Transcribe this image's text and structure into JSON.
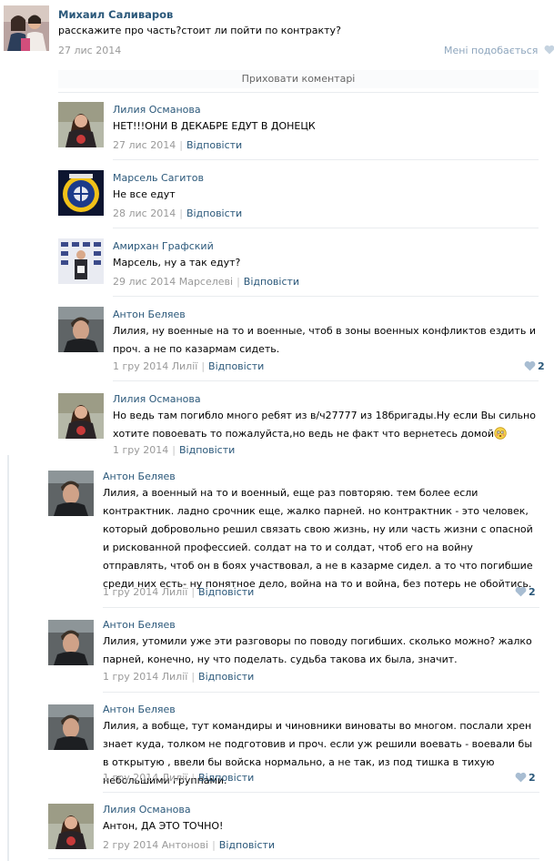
{
  "post": {
    "author": "Михаил Саливаров",
    "text": "расскажите про часть?стоит ли пойти по контракту?",
    "date": "27 лис 2014",
    "like_label": "Мені подобається"
  },
  "hide_comments": "Приховати коментарі",
  "reply_label": "Відповісти",
  "comments": [
    {
      "author": "Лилия Османова",
      "text": "НЕТ!!!ОНИ В ДЕКАБРЕ ЕДУТ В ДОНЕЦК",
      "date": "27 лис 2014"
    },
    {
      "author": "Марсель Сагитов",
      "text": "Не все едут",
      "date": "28 лис 2014"
    },
    {
      "author": "Амирхан Графский",
      "text": "Марсель, ну а так едут?",
      "date": "29 лис 2014 Марселеві"
    },
    {
      "author": "Антон Беляев",
      "text": "Лилия, ну военные на то и военные, чтоб в зоны военных конфликтов ездить и проч. а не по казармам сидеть.",
      "date": "1 гру 2014 Лилії",
      "likes": "2"
    },
    {
      "author": "Лилия Османова",
      "text": "Но ведь там погибло много ребят из в/ч27777 из 18бригады.Ну если Вы сильно хотите повоевать то пожалуйста,но ведь не факт что вернетесь домой",
      "date": "1 гру 2014"
    },
    {
      "author": "Антон Беляев",
      "text": "Лилия, а военный на то и военный, еще раз повторяю. тем более если контрактник. ладно срочник еще, жалко парней. но контрактник - это человек, который добровольно решил связать свою жизнь, ну или часть жизни с опасной и рискованной профессией. солдат на то и солдат, чтоб его на войну отправлять, чтоб он в боях участвовал, а не в казарме сидел. а то что погибшие среди них есть- ну понятное дело, война на то и война, без потерь не обойтись.",
      "date": "1 гру 2014 Лилії",
      "likes": "2"
    },
    {
      "author": "Антон Беляев",
      "text": "Лилия, утомили уже эти разговоры по поводу погибших. сколько можно? жалко парней, конечно, ну что поделать. судьба такова их была, значит.",
      "date": "1 гру 2014 Лилії"
    },
    {
      "author": "Антон Беляев",
      "text": "Лилия, а вобще, тут командиры и чиновники виноваты во многом. послали хрен знает куда, толком не подготовив и проч. если уж решили воевать - воевали бы в открытую , ввели бы войска нормально, а не так, из под тишка в тихую небольшими группами.",
      "date": "1 гру 2014 Лилії",
      "likes": "2"
    },
    {
      "author": "Лилия Османова",
      "text": "Антон, ДА ЭТО ТОЧНО!",
      "date": "2 гру 2014 Антонові"
    }
  ],
  "colors": {
    "link": "#2b587a",
    "meta": "#999999",
    "separator": "#e9ecef"
  }
}
